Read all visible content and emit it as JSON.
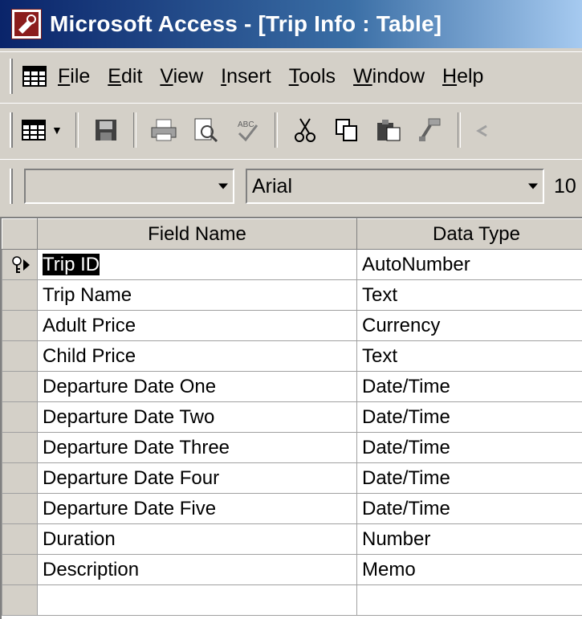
{
  "window": {
    "title": "Microsoft Access - [Trip Info : Table]"
  },
  "menu": {
    "items": [
      {
        "label_u": "F",
        "label_rest": "ile"
      },
      {
        "label_u": "E",
        "label_rest": "dit"
      },
      {
        "label_u": "V",
        "label_rest": "iew"
      },
      {
        "label_u": "I",
        "label_rest": "nsert"
      },
      {
        "label_u": "T",
        "label_rest": "ools"
      },
      {
        "label_u": "W",
        "label_rest": "indow"
      },
      {
        "label_u": "H",
        "label_rest": "elp"
      }
    ]
  },
  "formatbar": {
    "object_combo_value": "",
    "font_name": "Arial",
    "font_size": "10"
  },
  "grid": {
    "columns": [
      "Field Name",
      "Data Type"
    ],
    "rows": [
      {
        "field": "Trip ID",
        "type": "AutoNumber",
        "primary_key": true,
        "current": true
      },
      {
        "field": "Trip Name",
        "type": "Text"
      },
      {
        "field": "Adult Price",
        "type": "Currency"
      },
      {
        "field": "Child Price",
        "type": "Text"
      },
      {
        "field": "Departure Date One",
        "type": "Date/Time"
      },
      {
        "field": "Departure Date Two",
        "type": "Date/Time"
      },
      {
        "field": "Departure Date Three",
        "type": "Date/Time"
      },
      {
        "field": "Departure Date Four",
        "type": "Date/Time"
      },
      {
        "field": "Departure Date Five",
        "type": "Date/Time"
      },
      {
        "field": "Duration",
        "type": "Number"
      },
      {
        "field": "Description",
        "type": "Memo"
      },
      {
        "field": "",
        "type": ""
      }
    ]
  },
  "icons": {
    "app": "access-key-icon",
    "toolbar": [
      "table-view-icon",
      "save-icon",
      "print-icon",
      "print-preview-icon",
      "spelling-icon",
      "cut-icon",
      "copy-icon",
      "paste-icon",
      "format-painter-icon"
    ]
  }
}
